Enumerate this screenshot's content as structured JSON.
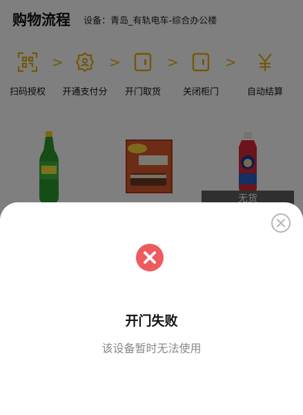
{
  "header": {
    "title": "购物流程",
    "device_label": "设备：",
    "device_name": "青岛_有轨电车-综合办公楼"
  },
  "steps": [
    {
      "label": "扫码授权",
      "icon": "qr-scan-icon"
    },
    {
      "label": "开通支付分",
      "icon": "payment-score-icon"
    },
    {
      "label": "开门取货",
      "icon": "open-door-icon"
    },
    {
      "label": "关闭柜门",
      "icon": "close-door-icon"
    },
    {
      "label": "自动结算",
      "icon": "yuan-settle-icon"
    }
  ],
  "step_arrow": ">",
  "products": [
    {
      "name": "soda-bottle"
    },
    {
      "name": "wafer-box"
    },
    {
      "name": "kids-drink-bottle",
      "status": "无货"
    }
  ],
  "modal": {
    "title": "开门失败",
    "message": "该设备暂时无法使用"
  },
  "colors": {
    "accent": "#e2b10a",
    "error": "#ef5a5e",
    "nostock_bg": "#5e5e5e"
  }
}
